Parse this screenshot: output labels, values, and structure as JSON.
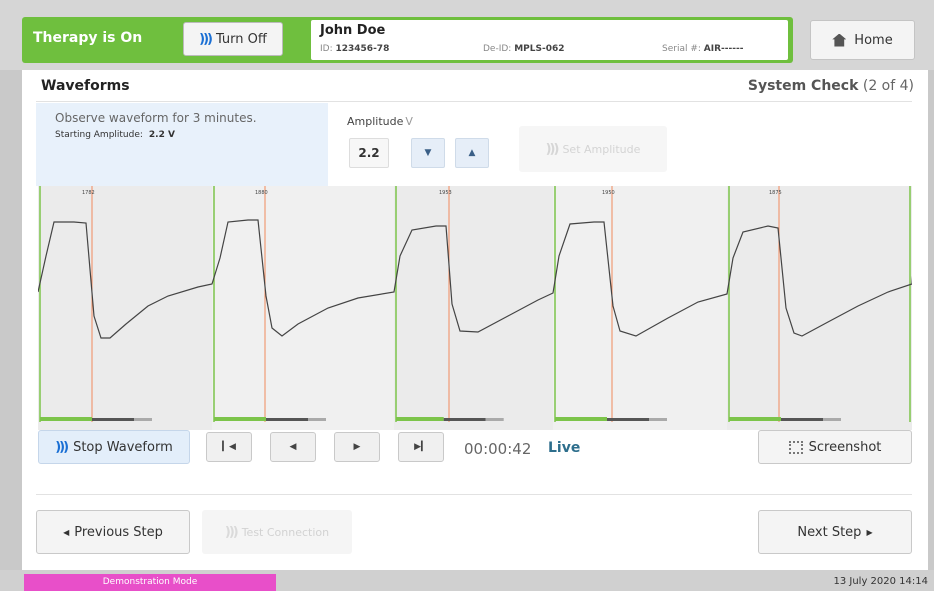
{
  "header": {
    "therapy_status": "Therapy is On",
    "turn_off_label": "Turn Off",
    "home_label": "Home",
    "brand_green": "#6fbf3e"
  },
  "patient": {
    "name": "John Doe",
    "id_label": "ID:",
    "id_value": "123456-78",
    "deid_label": "De-ID:",
    "deid_value": "MPLS-062",
    "serial_label": "Serial #:",
    "serial_value": "AIR------"
  },
  "page": {
    "title": "Waveforms",
    "step_label": "System Check",
    "step_progress": "(2 of 4)"
  },
  "instructions": {
    "text": "Observe waveform for 3 minutes.",
    "starting_amp_label": "Starting Amplitude:",
    "starting_amp_value": "2.2 V"
  },
  "amplitude": {
    "label": "Amplitude",
    "unit": "V",
    "value": "2.2",
    "down_icon": "triangle-down-icon",
    "up_icon": "triangle-up-icon",
    "set_label": "Set Amplitude"
  },
  "waveform": {
    "cycle_labels": [
      "1782",
      "1880",
      "1953",
      "1950",
      "1875"
    ]
  },
  "playback": {
    "stop_label": "Stop Waveform",
    "first_icon": "skip-to-start-icon",
    "back_icon": "step-back-icon",
    "forward_icon": "step-forward-icon",
    "last_icon": "skip-to-end-icon",
    "timer": "00:00:42",
    "live_label": "Live",
    "screenshot_label": "Screenshot"
  },
  "nav": {
    "previous_label": "Previous Step",
    "test_connection_label": "Test Connection",
    "next_label": "Next Step"
  },
  "footer": {
    "demo_mode": "Demonstration Mode",
    "datetime": "13 July 2020 14:14",
    "demo_color": "#e84fc9"
  }
}
